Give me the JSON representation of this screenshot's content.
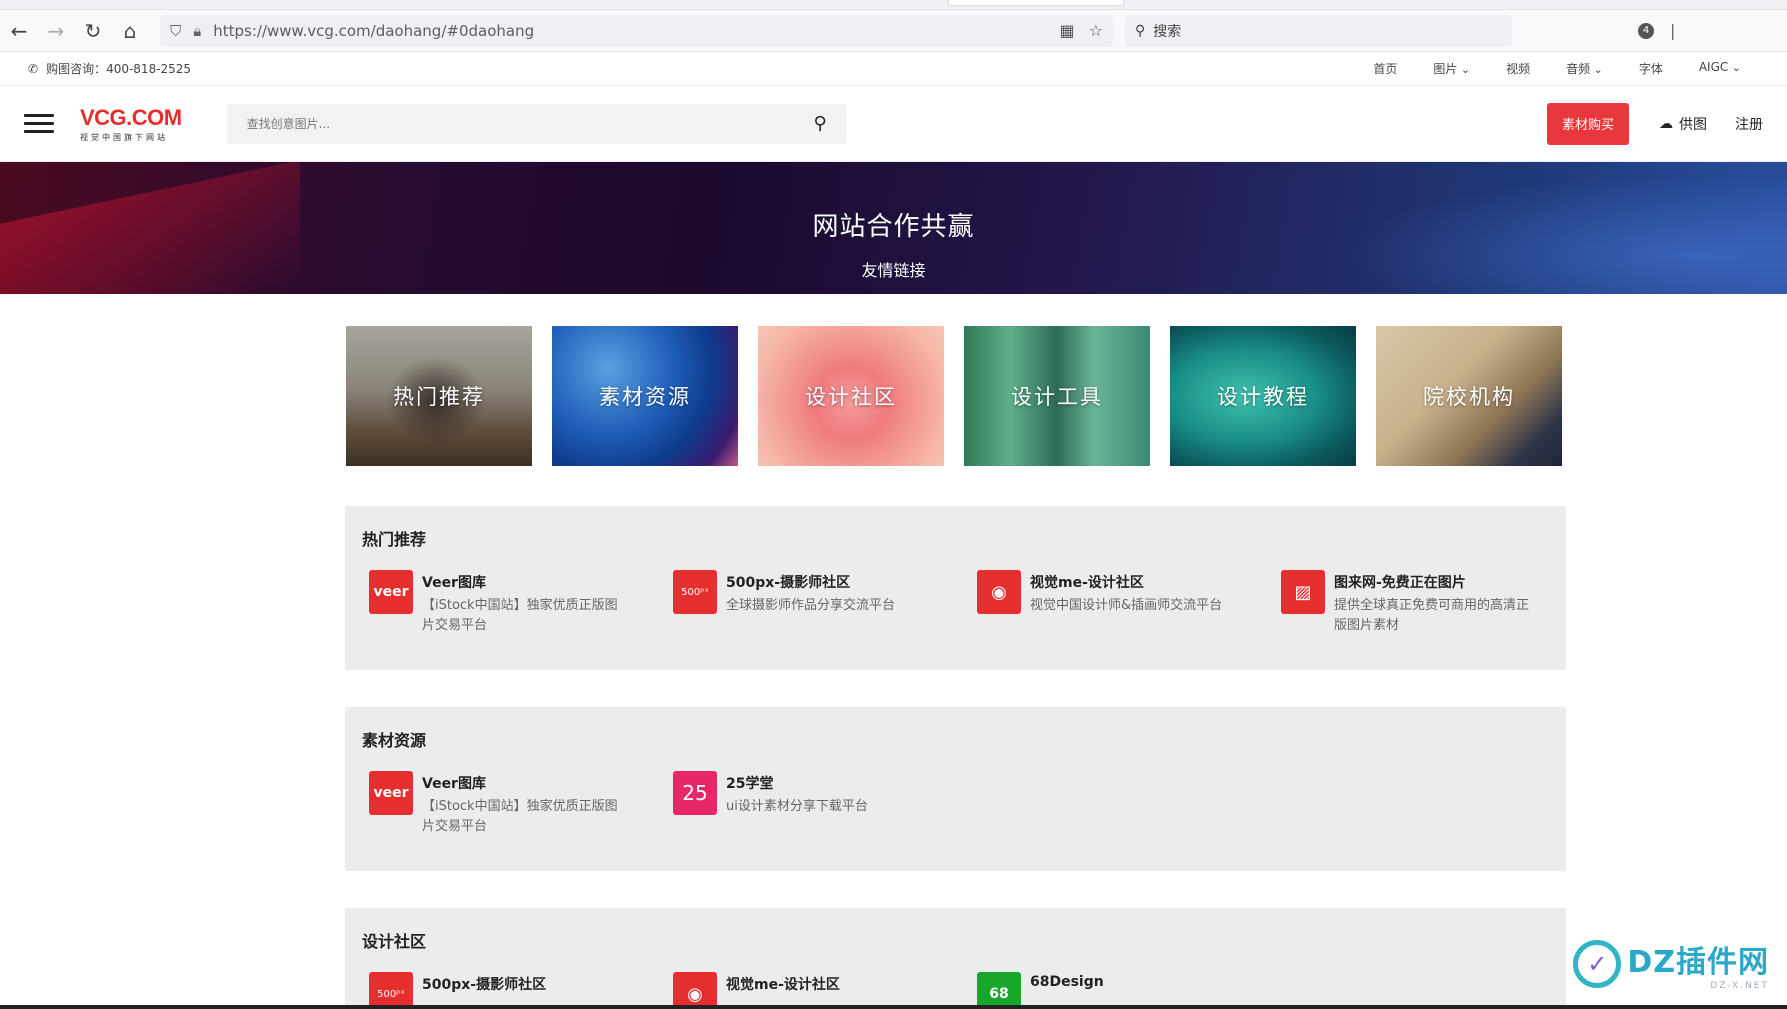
{
  "browser": {
    "url": "https://www.vcg.com/daohang/#0daohang",
    "search_placeholder": "搜索",
    "ext_count": "4"
  },
  "infobar": {
    "phone": "购图咨询：400-818-2525",
    "menu": [
      "首页",
      "图片",
      "视频",
      "音频",
      "字体",
      "AIGC"
    ]
  },
  "header": {
    "logo_main": "VCG.COM",
    "logo_sub": "视觉中国旗下网站",
    "search_placeholder": "查找创意图片...",
    "buy_label": "素材购买",
    "supply_label": "供图",
    "register_label": "注册"
  },
  "banner": {
    "title": "网站合作共赢",
    "subtitle": "友情链接"
  },
  "categories": [
    "热门推荐",
    "素材资源",
    "设计社区",
    "设计工具",
    "设计教程",
    "院校机构"
  ],
  "sections": [
    {
      "title": "热门推荐",
      "items": [
        {
          "name": "Veer图库",
          "desc": "【iStock中国站】独家优质正版图片交易平台",
          "icon": "veer"
        },
        {
          "name": "500px-摄影师社区",
          "desc": "全球摄影师作品分享交流平台",
          "icon": "500px"
        },
        {
          "name": "视觉me-设计社区",
          "desc": "视觉中国设计师&插画师交流平台",
          "icon": "eye"
        },
        {
          "name": "图来网-免费正在图片",
          "desc": "提供全球真正免费可商用的高清正版图片素材",
          "icon": "picture"
        }
      ]
    },
    {
      "title": "素材资源",
      "items": [
        {
          "name": "Veer图库",
          "desc": "【iStock中国站】独家优质正版图片交易平台",
          "icon": "veer"
        },
        {
          "name": "25学堂",
          "desc": "ui设计素材分享下载平台",
          "icon": "25"
        }
      ]
    },
    {
      "title": "设计社区",
      "items": [
        {
          "name": "500px-摄影师社区",
          "desc": "",
          "icon": "500px"
        },
        {
          "name": "视觉me-设计社区",
          "desc": "",
          "icon": "eye"
        },
        {
          "name": "68Design",
          "desc": "",
          "icon": "68"
        }
      ]
    }
  ],
  "icons": {
    "veer_text": "veer",
    "500px_text": "500ᵖˣ",
    "25_text": "25",
    "68_text": "68"
  },
  "watermark": {
    "big": "DZ插件网",
    "small": "DZ-X.NET"
  },
  "colors": {
    "accent": "#e62e2e",
    "buy_button": "#e8383d",
    "section_bg": "#eaeced"
  }
}
